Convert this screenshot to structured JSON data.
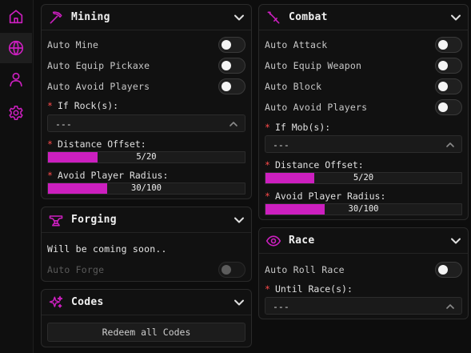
{
  "accent_color": "#cc1fbf",
  "sidebar": {
    "items": [
      {
        "icon": "home-icon",
        "active": false
      },
      {
        "icon": "globe-icon",
        "active": true
      },
      {
        "icon": "user-icon",
        "active": false
      },
      {
        "icon": "gear-icon",
        "active": false
      }
    ]
  },
  "mining": {
    "title": "Mining",
    "icon": "pickaxe-icon",
    "toggles": [
      {
        "label": "Auto Mine",
        "on": false
      },
      {
        "label": "Auto Equip Pickaxe",
        "on": false
      },
      {
        "label": "Auto Avoid Players",
        "on": false
      }
    ],
    "rock_label": "If Rock(s):",
    "rock_value": "---",
    "distance_label": "Distance Offset:",
    "distance_value": "5/20",
    "distance_fraction": 0.25,
    "radius_label": "Avoid Player Radius:",
    "radius_value": "30/100",
    "radius_fraction": 0.3
  },
  "forging": {
    "title": "Forging",
    "icon": "anvil-icon",
    "message": "Will be coming soon..",
    "toggle_label": "Auto Forge"
  },
  "codes": {
    "title": "Codes",
    "icon": "sparkles-icon",
    "button_label": "Redeem all Codes"
  },
  "combat": {
    "title": "Combat",
    "icon": "sword-icon",
    "toggles": [
      {
        "label": "Auto Attack",
        "on": false
      },
      {
        "label": "Auto Equip Weapon",
        "on": false
      },
      {
        "label": "Auto Block",
        "on": false
      },
      {
        "label": "Auto Avoid Players",
        "on": false
      }
    ],
    "mob_label": "If Mob(s):",
    "mob_value": "---",
    "distance_label": "Distance Offset:",
    "distance_value": "5/20",
    "distance_fraction": 0.25,
    "radius_label": "Avoid Player Radius:",
    "radius_value": "30/100",
    "radius_fraction": 0.3
  },
  "race": {
    "title": "Race",
    "icon": "eye-icon",
    "toggle_label": "Auto Roll Race",
    "until_label": "Until Race(s):",
    "until_value": "---"
  }
}
